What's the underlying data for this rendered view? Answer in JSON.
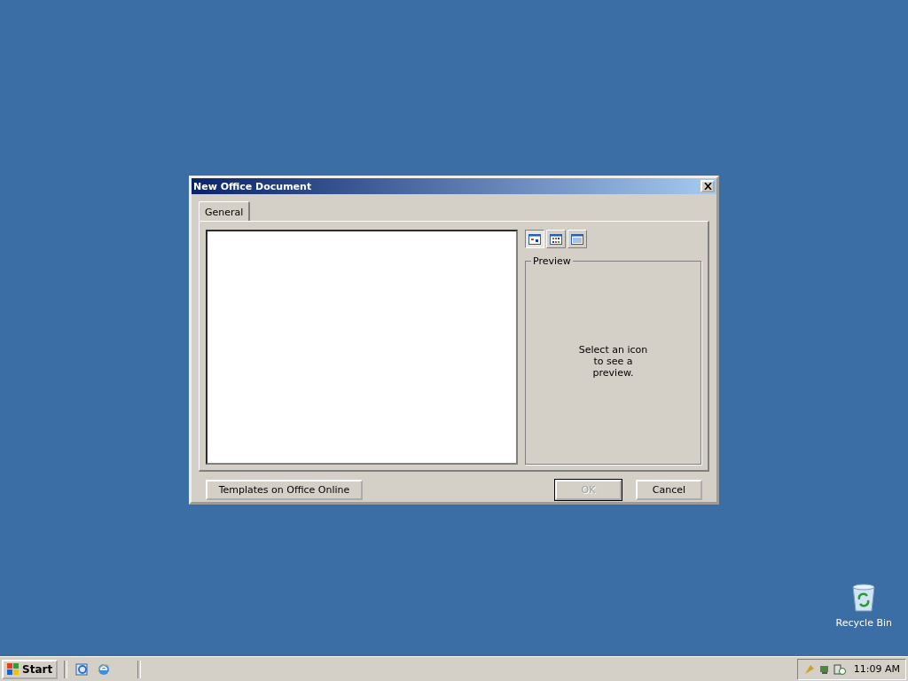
{
  "dialog": {
    "title": "New Office Document",
    "tabs": [
      {
        "label": "General",
        "selected": true
      }
    ],
    "view_buttons": [
      {
        "kind": "large-icons",
        "selected": true
      },
      {
        "kind": "list",
        "selected": false
      },
      {
        "kind": "details",
        "selected": false
      }
    ],
    "preview": {
      "label": "Preview",
      "message": "Select an icon to see a preview."
    },
    "buttons": [
      {
        "label": "Templates on Office Online",
        "disabled": false
      },
      {
        "label": "OK",
        "disabled": true
      },
      {
        "label": "Cancel",
        "disabled": false
      }
    ]
  },
  "desktop_icons": [
    {
      "label": "Recycle Bin"
    }
  ],
  "taskbar": {
    "start": "Start",
    "clock": "11:09 AM"
  }
}
